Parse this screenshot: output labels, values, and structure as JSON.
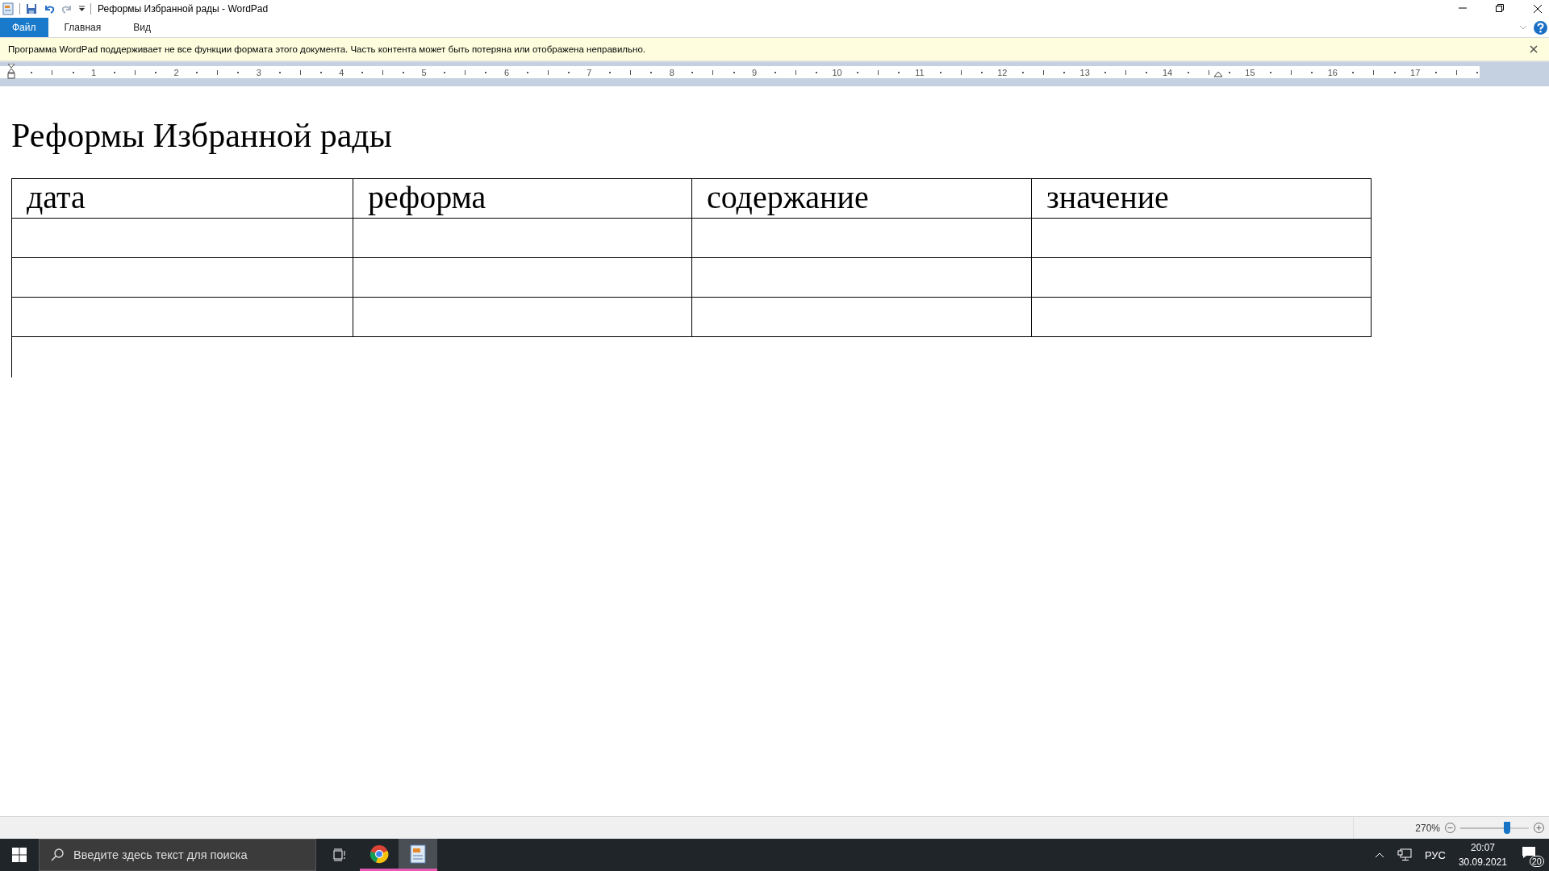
{
  "window": {
    "title": "Реформы Избранной рады - WordPad"
  },
  "ribbon": {
    "file_menu": "Файл",
    "tabs": [
      "Главная",
      "Вид"
    ]
  },
  "info_bar": {
    "message": "Программа WordPad поддерживает не все функции формата этого документа. Часть контента может быть потеряна или отображена неправильно."
  },
  "ruler": {
    "numbers": [
      "1",
      "2",
      "3",
      "4",
      "5",
      "6",
      "7",
      "8",
      "9",
      "10",
      "11",
      "12",
      "13",
      "14",
      "15",
      "16",
      "17"
    ]
  },
  "document": {
    "heading": "Реформы Избранной рады",
    "table": {
      "columns": [
        "дата",
        "реформа",
        "содержание",
        "значение"
      ],
      "rows": [
        {
          "empty": true
        },
        {
          "empty": true
        },
        {
          "empty": true
        }
      ]
    }
  },
  "status_bar": {
    "zoom": "270%",
    "zoom_slider": {
      "level": 0.68
    }
  },
  "taskbar": {
    "search_placeholder": "Введите здесь текст для поиска",
    "apps": [
      {
        "kind": "browser",
        "active": false
      },
      {
        "kind": "wordpad",
        "active": true
      }
    ],
    "language": "РУС",
    "time": "20:07",
    "date": "30.09.2021",
    "notifications": "20"
  }
}
